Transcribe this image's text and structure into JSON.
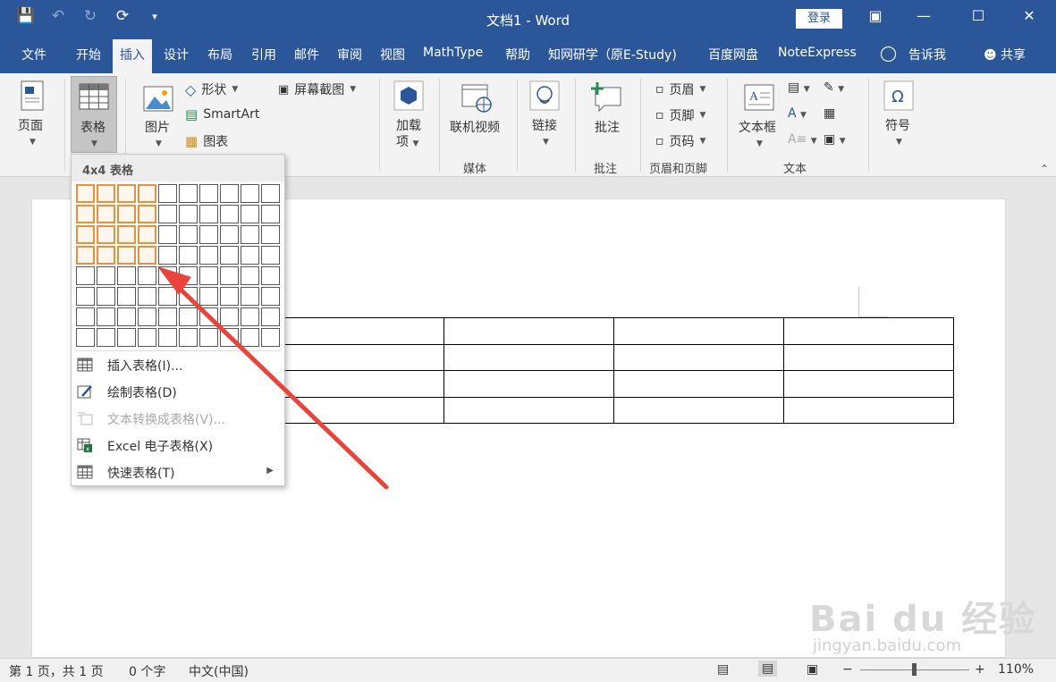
{
  "window": {
    "title": "文档1  -  Word",
    "login_label": "登录",
    "qat_icons": [
      "save-icon",
      "undo-icon",
      "redo-icon",
      "repeat-icon",
      "customize-icon"
    ]
  },
  "tabs": {
    "file": "文件",
    "home": "开始",
    "insert": "插入",
    "design": "设计",
    "layout": "布局",
    "references": "引用",
    "mailings": "邮件",
    "review": "审阅",
    "view": "视图",
    "mathtype": "MathType",
    "help": "帮助",
    "cnki": "知网研学（原E-Study)",
    "baidu": "百度网盘",
    "noteexpress": "NoteExpress",
    "tellme": "告诉我",
    "share": "共享"
  },
  "ribbon": {
    "page": "页面",
    "table": "表格",
    "picture": "图片",
    "shapes": "形状",
    "smartart": "SmartArt",
    "chart": "图表",
    "screenshot": "屏幕截图",
    "addins_line1": "加载",
    "addins_line2": "项",
    "online_video": "联机视频",
    "link": "链接",
    "comment": "批注",
    "header": "页眉",
    "footer": "页脚",
    "page_number": "页码",
    "textbox": "文本框",
    "symbol": "符号",
    "groups": {
      "media": "媒体",
      "comments": "批注",
      "header_footer": "页眉和页脚",
      "text": "文本"
    }
  },
  "dropdown": {
    "header": "4x4 表格",
    "rows": 8,
    "cols": 10,
    "selected_rows": 4,
    "selected_cols": 4,
    "items": {
      "insert_table": "插入表格(I)...",
      "draw_table": "绘制表格(D)",
      "text_to_table": "文本转换成表格(V)...",
      "excel_table": "Excel 电子表格(X)",
      "quick_tables": "快速表格(T)"
    }
  },
  "statusbar": {
    "page": "第 1 页，共 1 页",
    "words": "0 个字",
    "language": "中文(中国)",
    "zoom": "110%",
    "zoom_minus": "−",
    "zoom_plus": "+"
  },
  "watermark": {
    "main": "Bai du 经验",
    "sub": "jingyan.baidu.com"
  },
  "colors": {
    "title_bar": "#2b579a",
    "grid_highlight": "#e8903a",
    "arrow": "#e8443a"
  }
}
